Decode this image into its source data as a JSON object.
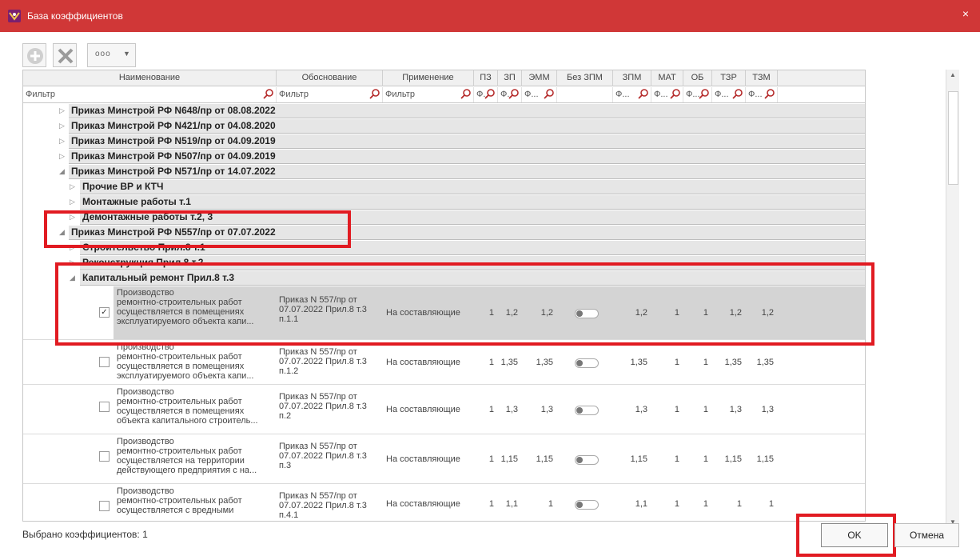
{
  "window": {
    "title": "База коэффициентов",
    "close": "×"
  },
  "toolbar": {
    "more_label": "ooo"
  },
  "grid": {
    "columns": [
      "Наименование",
      "Обоснование",
      "Применение",
      "ПЗ",
      "ЗП",
      "ЭММ",
      "Без ЗПМ",
      "ЗПМ",
      "МАТ",
      "ОБ",
      "ТЗР",
      "ТЗМ"
    ],
    "filters": {
      "name": "Фильтр",
      "basis": "Фильтр",
      "apply": "Фильтр",
      "short": "Ф.",
      "long": "Ф..."
    },
    "groups": [
      "Приказ Минстрой РФ N648/пр от 08.08.2022",
      "Приказ Минстрой РФ N421/пр от 04.08.2020",
      "Приказ Минстрой РФ N519/пр от 04.09.2019",
      "Приказ Минстрой РФ N507/пр от 04.09.2019",
      "Приказ Минстрой РФ N571/пр от 14.07.2022",
      "Прочие ВР и КТЧ",
      "Монтажные работы т.1",
      "Демонтажные работы т.2, 3",
      "Приказ Минстрой РФ N557/пр от 07.07.2022",
      "Строительство Прил.8 т.1",
      "Реконструкция Прил.8 т.2",
      "Капитальный ремонт Прил.8 т.3"
    ],
    "rows": [
      {
        "name": [
          "Производство",
          "ремонтно-строительных работ",
          "осуществляется в помещениях",
          "эксплуатируемого объекта капи..."
        ],
        "basis": [
          "Приказ N 557/пр от",
          "07.07.2022 Прил.8 т.3",
          "п.1.1"
        ],
        "apply": "На составляющие",
        "checked": "✓",
        "vals": [
          "1",
          "1,2",
          "1,2",
          "1,2",
          "1",
          "1",
          "1,2",
          "1,2"
        ]
      },
      {
        "name": [
          "Производство",
          "ремонтно-строительных работ",
          "осуществляется в помещениях",
          "эксплуатируемого объекта капи..."
        ],
        "basis": [
          "Приказ N 557/пр от",
          "07.07.2022 Прил.8 т.3",
          "п.1.2"
        ],
        "apply": "На составляющие",
        "checked": "",
        "vals": [
          "1",
          "1,35",
          "1,35",
          "1,35",
          "1",
          "1",
          "1,35",
          "1,35"
        ]
      },
      {
        "name": [
          "Производство",
          "ремонтно-строительных работ",
          "осуществляется в помещениях",
          "объекта капитального строитель..."
        ],
        "basis": [
          "Приказ N 557/пр от",
          "07.07.2022 Прил.8 т.3",
          "п.2"
        ],
        "apply": "На составляющие",
        "checked": "",
        "vals": [
          "1",
          "1,3",
          "1,3",
          "1,3",
          "1",
          "1",
          "1,3",
          "1,3"
        ]
      },
      {
        "name": [
          "Производство",
          "ремонтно-строительных работ",
          "осуществляется на территории",
          "действующего предприятия с на..."
        ],
        "basis": [
          "Приказ N 557/пр от",
          "07.07.2022 Прил.8 т.3",
          "п.3"
        ],
        "apply": "На составляющие",
        "checked": "",
        "vals": [
          "1",
          "1,15",
          "1,15",
          "1,15",
          "1",
          "1",
          "1,15",
          "1,15"
        ]
      },
      {
        "name": [
          "Производство",
          "ремонтно-строительных работ",
          "осуществляется с вредными",
          ""
        ],
        "basis": [
          "Приказ N 557/пр от",
          "07.07.2022 Прил.8 т.3",
          "п.4.1"
        ],
        "apply": "На составляющие",
        "checked": "",
        "vals": [
          "1",
          "1,1",
          "1",
          "1,1",
          "1",
          "1",
          "1",
          "1"
        ]
      }
    ]
  },
  "footer": {
    "status": "Выбрано коэффициентов: 1",
    "ok": "OK",
    "cancel": "Отмена"
  },
  "colors": {
    "titlebar": "#d03737",
    "highlight": "#e11b22",
    "group_bg": "#e6e6e6",
    "selected_row": "#d4d4d4"
  },
  "icons": [
    "app-logo-icon",
    "close-icon",
    "add-icon",
    "delete-icon",
    "more-icon",
    "search-icon",
    "expand-icon",
    "collapse-icon",
    "toggle-icon",
    "checkbox-icon",
    "scroll-up-icon",
    "scroll-down-icon"
  ]
}
